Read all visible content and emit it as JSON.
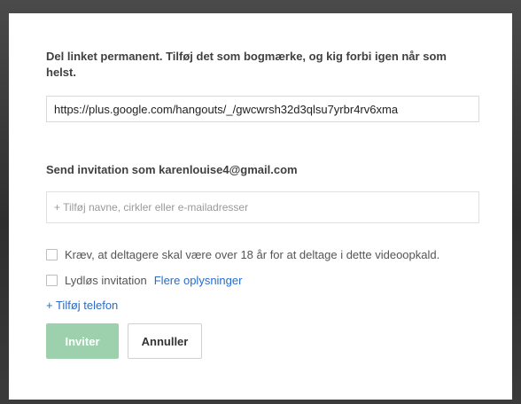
{
  "dialog": {
    "share_heading": "Del linket permanent. Tilføj det som bogmærke, og kig forbi igen når som helst.",
    "share_url": "https://plus.google.com/hangouts/_/gwcwrsh32d3qlsu7yrbr4rv6xma",
    "invite_heading": "Send invitation som karenlouise4@gmail.com",
    "invite_placeholder": "+ Tilføj navne, cirkler eller e-mailadresser",
    "age_checkbox_label": "Kræv, at deltagere skal være over 18 år for at deltage i dette videoopkald.",
    "silent_checkbox_label": "Lydløs invitation",
    "more_info_link": "Flere oplysninger",
    "add_phone_link": "+ Tilføj telefon",
    "invite_button": "Inviter",
    "cancel_button": "Annuller"
  },
  "colors": {
    "link": "#2a6cc4",
    "invite_button_bg": "#9dd1ad"
  }
}
